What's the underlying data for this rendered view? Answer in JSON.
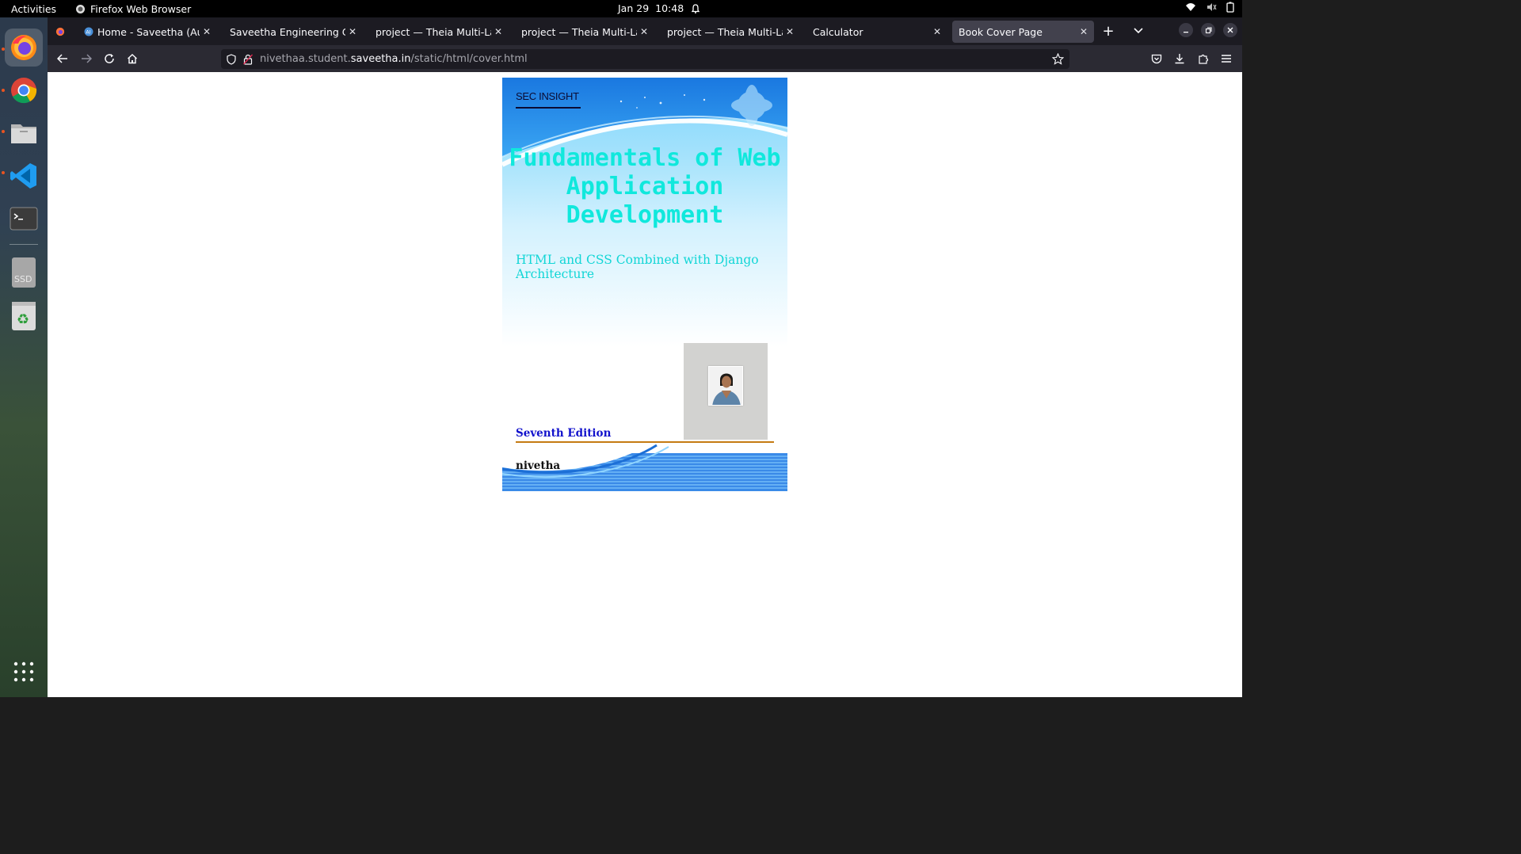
{
  "system": {
    "activities": "Activities",
    "app_name": "Firefox Web Browser",
    "date": "Jan 29",
    "time": "10:48"
  },
  "dock": {
    "items": [
      {
        "name": "firefox",
        "icon": "firefox-icon"
      },
      {
        "name": "chrome",
        "icon": "chrome-icon"
      },
      {
        "name": "files",
        "icon": "files-icon"
      },
      {
        "name": "vscode",
        "icon": "vscode-icon"
      },
      {
        "name": "terminal",
        "icon": "terminal-icon"
      },
      {
        "name": "ssd",
        "icon": "drive-icon"
      },
      {
        "name": "trash",
        "icon": "trash-icon"
      },
      {
        "name": "apps",
        "icon": "grid-icon"
      }
    ]
  },
  "tabs": [
    {
      "title": "Home - Saveetha (Autono",
      "active": false
    },
    {
      "title": "Saveetha Engineering Colleg",
      "active": false
    },
    {
      "title": "project — Theia Multi-Langu",
      "active": false
    },
    {
      "title": "project — Theia Multi-Langu",
      "active": false
    },
    {
      "title": "project — Theia Multi-Langu",
      "active": false
    },
    {
      "title": "Calculator",
      "active": false
    },
    {
      "title": "Book Cover Page",
      "active": true
    }
  ],
  "url": {
    "prefix": "nivethaa.student.",
    "domain": "saveetha.in",
    "path": "/static/html/cover.html"
  },
  "cover": {
    "brand": "SEC INSIGHT",
    "title": "Fundamentals of Web Application Development",
    "subtitle": "HTML and CSS Combined with Django Architecture",
    "edition": "Seventh Edition",
    "author": "nivetha",
    "colors": {
      "title": "#10e8dc",
      "subtitle": "#12d6d6",
      "edition": "#1111cc",
      "rule": "#c57a12"
    }
  }
}
